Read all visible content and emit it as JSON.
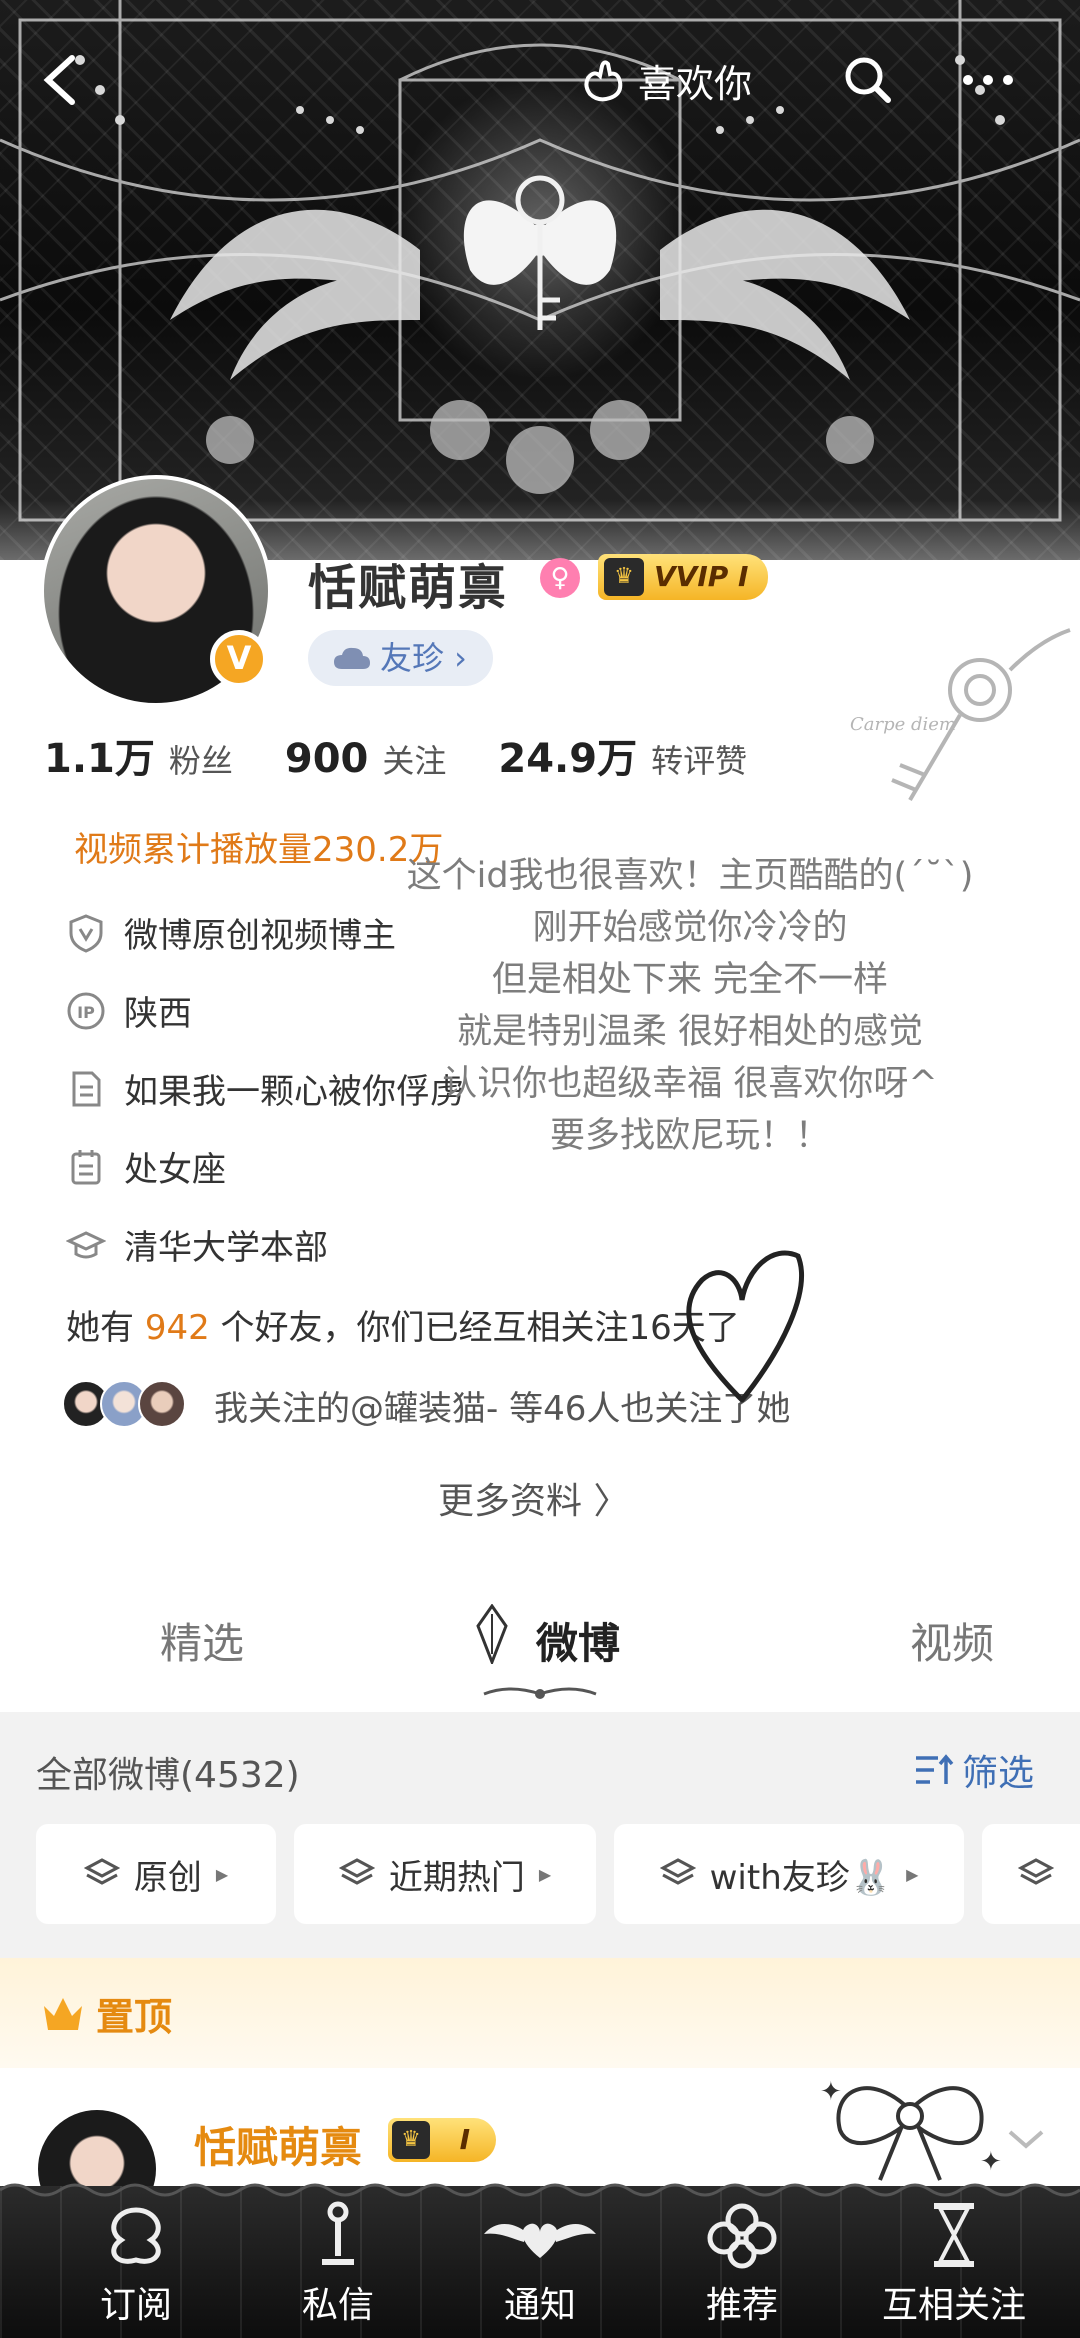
{
  "topbar": {
    "like_label": "喜欢你"
  },
  "profile": {
    "name": "恬赋萌禀",
    "vip_label": "VVIP I",
    "fan_badge": "友珍 ›",
    "stats": [
      {
        "value": "1.1万",
        "label": "粉丝"
      },
      {
        "value": "900",
        "label": "关注"
      },
      {
        "value": "24.9万",
        "label": "转评赞"
      }
    ],
    "play_count": "视频累计播放量230.2万",
    "info": [
      {
        "icon": "shield-v-icon",
        "text": "微博原创视频博主"
      },
      {
        "icon": "ip-icon",
        "text": "陕西"
      },
      {
        "icon": "document-icon",
        "text": "如果我一颗心被你俘虏"
      },
      {
        "icon": "calendar-icon",
        "text": "处女座"
      },
      {
        "icon": "graduation-cap-icon",
        "text": "清华大学本部"
      }
    ],
    "friends_prefix": "她有 ",
    "friends_count": "942",
    "friends_suffix": " 个好友，你们已经互相关注16天了",
    "mutual_text": "我关注的@罐装猫- 等46人也关注了她",
    "more_info": "更多资料 〉"
  },
  "handwritten_note": [
    "这个id我也很喜欢！主页酷酷的(ˊ˘ˋ)",
    "刚开始感觉你冷冷的",
    "但是相处下来 完全不一样",
    "就是特别温柔 很好相处的感觉",
    "认识你也超级幸福 很喜欢你呀^",
    "要多找欧尼玩！！"
  ],
  "banner_signature": "Carpe diem",
  "tabs": [
    "精选",
    "微博",
    "视频"
  ],
  "active_tab": "微博",
  "posts_header": {
    "all_posts": "全部微博(4532)",
    "filter": "筛选"
  },
  "chips": [
    "原创",
    "近期热门",
    "with友珍🐰"
  ],
  "pinned": {
    "label": "置顶",
    "author": "恬赋萌禀",
    "badge": "I"
  },
  "bottom_nav": [
    "订阅",
    "私信",
    "通知",
    "推荐",
    "互相关注"
  ],
  "colors": {
    "accent_orange": "#e07a18",
    "link_blue": "#3f6fb5",
    "vip_gold": "#f5b526"
  }
}
